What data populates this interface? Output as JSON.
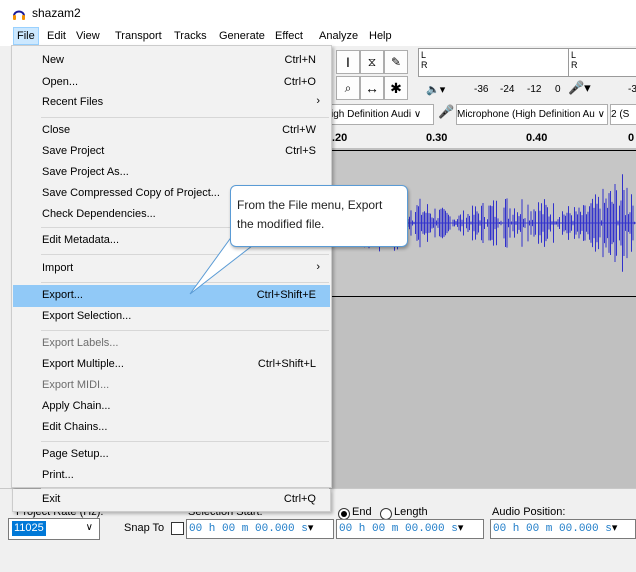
{
  "window": {
    "title": "shazam2"
  },
  "menubar": [
    "File",
    "Edit",
    "View",
    "Transport",
    "Tracks",
    "Generate",
    "Effect",
    "Analyze",
    "Help"
  ],
  "file_menu": {
    "items": [
      {
        "label": "New",
        "shortcut": "Ctrl+N"
      },
      {
        "label": "Open...",
        "shortcut": "Ctrl+O"
      },
      {
        "label": "Recent Files",
        "shortcut": ""
      },
      {
        "label": "Close",
        "shortcut": "Ctrl+W"
      },
      {
        "label": "Save Project",
        "shortcut": "Ctrl+S"
      },
      {
        "label": "Save Project As...",
        "shortcut": ""
      },
      {
        "label": "Save Compressed Copy of Project...",
        "shortcut": ""
      },
      {
        "label": "Check Dependencies...",
        "shortcut": ""
      },
      {
        "label": "Edit Metadata...",
        "shortcut": ""
      },
      {
        "label": "Import",
        "shortcut": ""
      },
      {
        "label": "Export...",
        "shortcut": "Ctrl+Shift+E"
      },
      {
        "label": "Export Selection...",
        "shortcut": ""
      },
      {
        "label": "Export Labels...",
        "shortcut": ""
      },
      {
        "label": "Export Multiple...",
        "shortcut": "Ctrl+Shift+L"
      },
      {
        "label": "Export MIDI...",
        "shortcut": ""
      },
      {
        "label": "Apply Chain...",
        "shortcut": ""
      },
      {
        "label": "Edit Chains...",
        "shortcut": ""
      },
      {
        "label": "Page Setup...",
        "shortcut": ""
      },
      {
        "label": "Print...",
        "shortcut": ""
      },
      {
        "label": "Exit",
        "shortcut": "Ctrl+Q"
      }
    ]
  },
  "callout": {
    "text": "From the File menu, Export the modified file."
  },
  "toolbar": {
    "meter_l": "L",
    "meter_r": "R",
    "meter_scale": [
      "-36",
      "-24",
      "-12",
      "0"
    ],
    "meter_scale_cut": "-3",
    "host_device": "igh Definition Audi",
    "mic_device": "Microphone (High Definition Au",
    "channels": "2 (S"
  },
  "ruler": {
    "ticks": [
      ".20",
      "0.30",
      "0.40",
      "0"
    ]
  },
  "bottom": {
    "project_rate_label": "Project Rate (Hz):",
    "project_rate_value": "11025",
    "snap_to_label": "Snap To",
    "selection_start_label": "Selection Start:",
    "end_label": "End",
    "length_label": "Length",
    "audio_position_label": "Audio Position:",
    "time_value": "00 h 00 m 00.000 s"
  }
}
